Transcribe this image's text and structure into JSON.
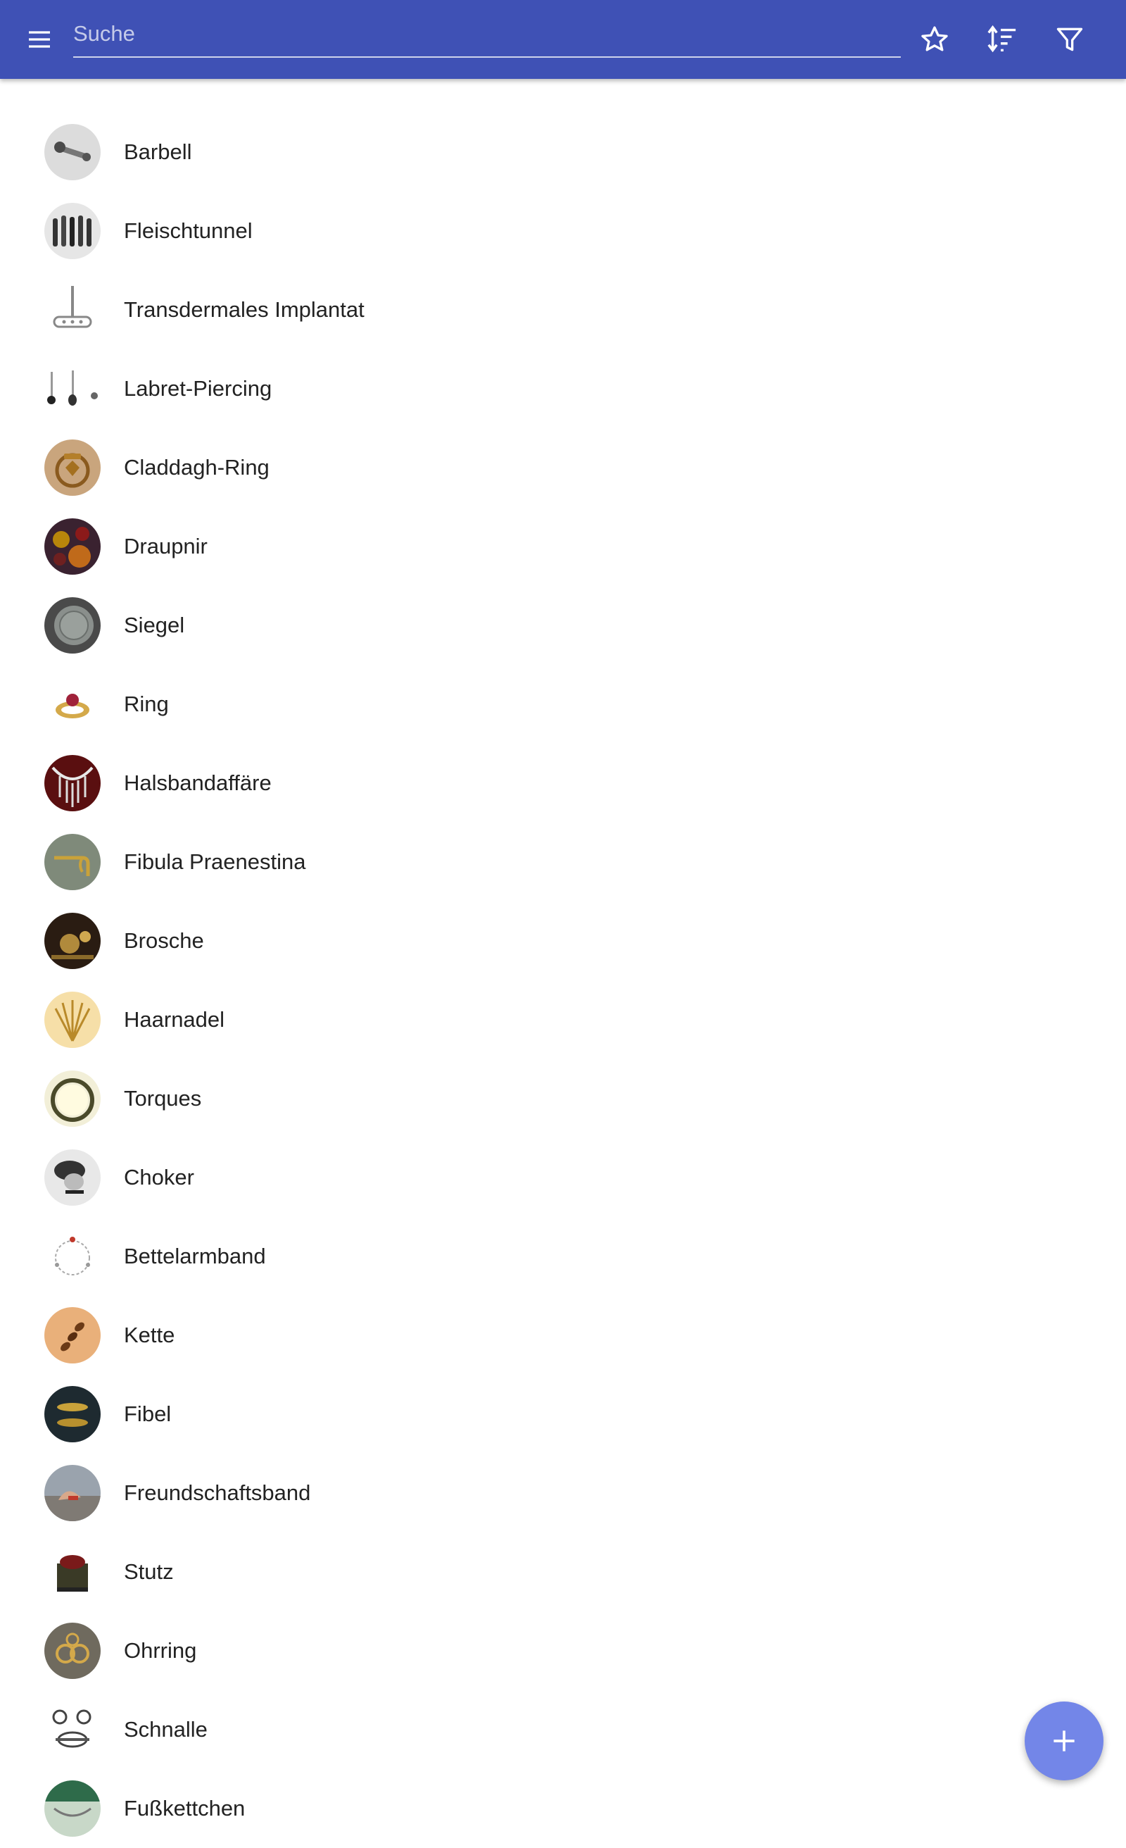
{
  "toolbar": {
    "menu_icon": "menu-icon",
    "search_placeholder": "Suche",
    "search_value": "",
    "favorites_icon": "star-outline-icon",
    "sort_icon": "sort-icon",
    "filter_icon": "filter-icon",
    "color": "#3f51b5"
  },
  "list": {
    "items": [
      {
        "label": "Barbell",
        "thumb": "barbell"
      },
      {
        "label": "Fleischtunnel",
        "thumb": "tunnel"
      },
      {
        "label": "Transdermales Implantat",
        "thumb": "implant"
      },
      {
        "label": "Labret-Piercing",
        "thumb": "labret"
      },
      {
        "label": "Claddagh-Ring",
        "thumb": "claddagh"
      },
      {
        "label": "Draupnir",
        "thumb": "draupnir"
      },
      {
        "label": "Siegel",
        "thumb": "seal"
      },
      {
        "label": "Ring",
        "thumb": "ring"
      },
      {
        "label": "Halsbandaffäre",
        "thumb": "necklace"
      },
      {
        "label": "Fibula Praenestina",
        "thumb": "fibula-praenestina"
      },
      {
        "label": "Brosche",
        "thumb": "brooch"
      },
      {
        "label": "Haarnadel",
        "thumb": "hairpin"
      },
      {
        "label": "Torques",
        "thumb": "torque"
      },
      {
        "label": "Choker",
        "thumb": "choker"
      },
      {
        "label": "Bettelarmband",
        "thumb": "charm-bracelet"
      },
      {
        "label": "Kette",
        "thumb": "chain"
      },
      {
        "label": "Fibel",
        "thumb": "fibel"
      },
      {
        "label": "Freundschaftsband",
        "thumb": "friendship-band"
      },
      {
        "label": "Stutz",
        "thumb": "stutz"
      },
      {
        "label": "Ohrring",
        "thumb": "earring"
      },
      {
        "label": "Schnalle",
        "thumb": "buckle"
      },
      {
        "label": "Fußkettchen",
        "thumb": "anklet"
      }
    ]
  },
  "fab": {
    "icon": "add-icon",
    "color": "#7386e8"
  }
}
